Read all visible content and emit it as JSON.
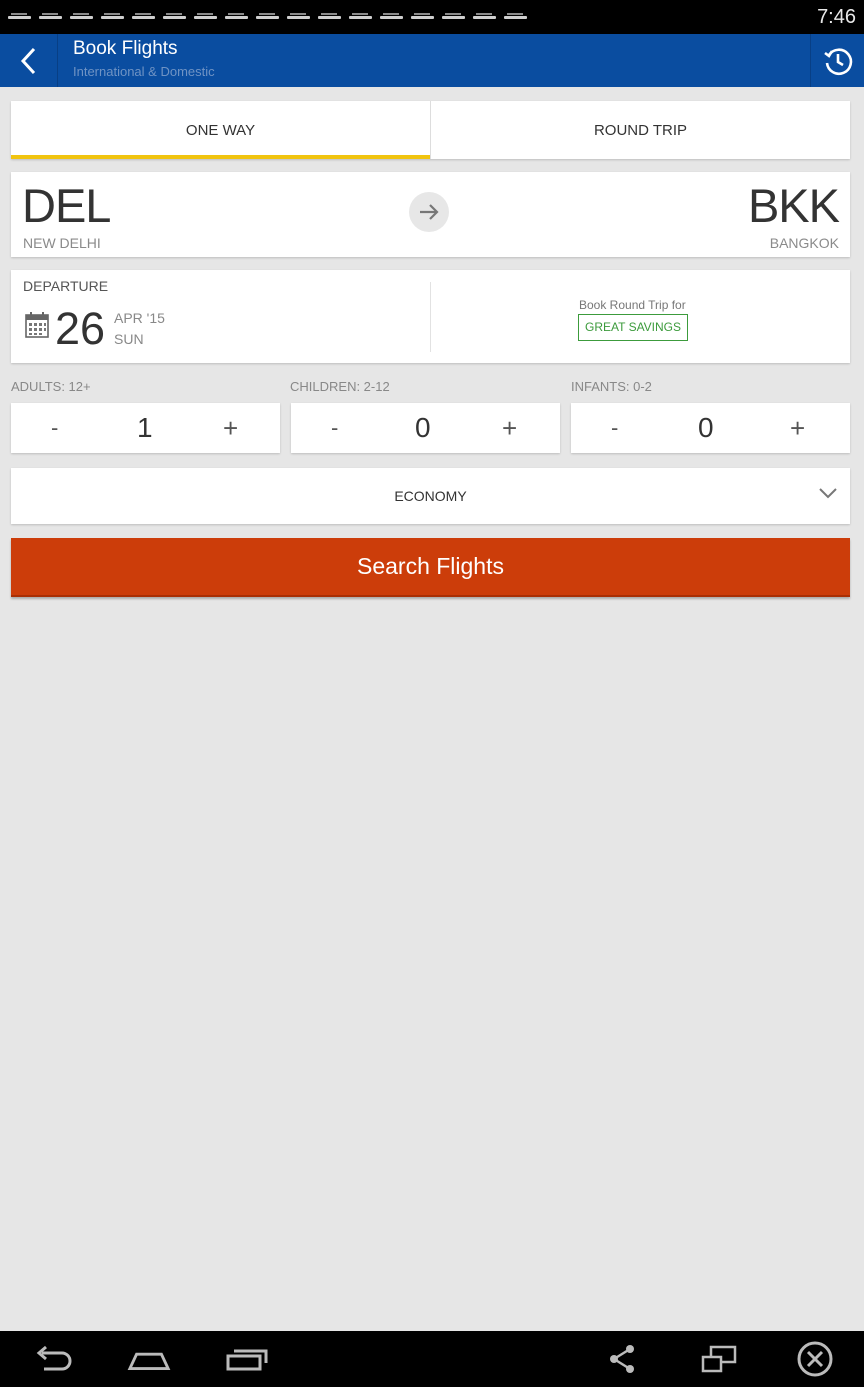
{
  "status_bar": {
    "time": "7:46",
    "notification_icons": [
      "ndtv-icon",
      "ndtv-icon",
      "ndtv-icon",
      "ndtv-icon",
      "ndtv-icon",
      "ndtv-icon",
      "ndtv-icon",
      "ndtv-icon",
      "ndtv-icon",
      "ndtv-icon",
      "ndtv-icon",
      "ndtv-icon",
      "ndtv-icon",
      "ndtv-icon",
      "ndtv-icon",
      "ndtv-icon",
      "ndtv-icon"
    ]
  },
  "app_bar": {
    "title": "Book Flights",
    "subtitle": "International & Domestic",
    "back_icon": "chevron-left-icon",
    "history_icon": "history-icon",
    "color": "#0a4da0"
  },
  "trip_tabs": [
    {
      "label": "ONE WAY",
      "active": true
    },
    {
      "label": "ROUND TRIP",
      "active": false
    }
  ],
  "route": {
    "from_code": "DEL",
    "from_city": "NEW DELHI",
    "to_code": "BKK",
    "to_city": "BANGKOK",
    "swap_icon": "arrow-right-icon"
  },
  "departure": {
    "label": "DEPARTURE",
    "day": "26",
    "month_year": "APR '15",
    "weekday": "SUN",
    "calendar_icon": "calendar-icon"
  },
  "round_trip_promo": {
    "text": "Book Round Trip for",
    "badge": "GREAT SAVINGS",
    "color": "#3c9b3c"
  },
  "passengers": {
    "adults": {
      "label": "ADULTS: 12+",
      "value": "1",
      "minus": "-",
      "plus": "+"
    },
    "children": {
      "label": "CHILDREN: 2-12",
      "value": "0",
      "minus": "-",
      "plus": "+"
    },
    "infants": {
      "label": "INFANTS: 0-2",
      "value": "0",
      "minus": "-",
      "plus": "+"
    }
  },
  "cabin_class": {
    "selected": "ECONOMY",
    "icon": "chevron-down-icon"
  },
  "search_button": {
    "label": "Search Flights",
    "color": "#cc3d0a"
  },
  "nav_bar": {
    "icons": [
      "back-icon",
      "home-icon",
      "recent-apps-icon",
      "share-icon",
      "screen-toggle-icon",
      "close-icon"
    ]
  }
}
